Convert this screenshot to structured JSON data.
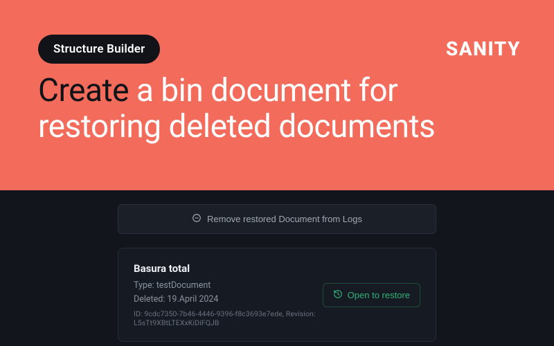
{
  "hero": {
    "pill": "Structure Builder",
    "title_accent": "Create",
    "title_rest": " a bin document for restoring deleted documents"
  },
  "brand": "SANITY",
  "actions": {
    "remove_label": "Remove restored Document from Logs"
  },
  "card": {
    "title": "Basura total",
    "type_label": "Type: testDocument",
    "deleted_label": "Deleted: 19.April 2024",
    "id_line": "ID: 9cdc7350-7b46-4446-9396-f8c3693e7ede, Revision: L5sTt9XBtLTEXxKiDiFQJB",
    "restore_label": "Open to restore"
  }
}
